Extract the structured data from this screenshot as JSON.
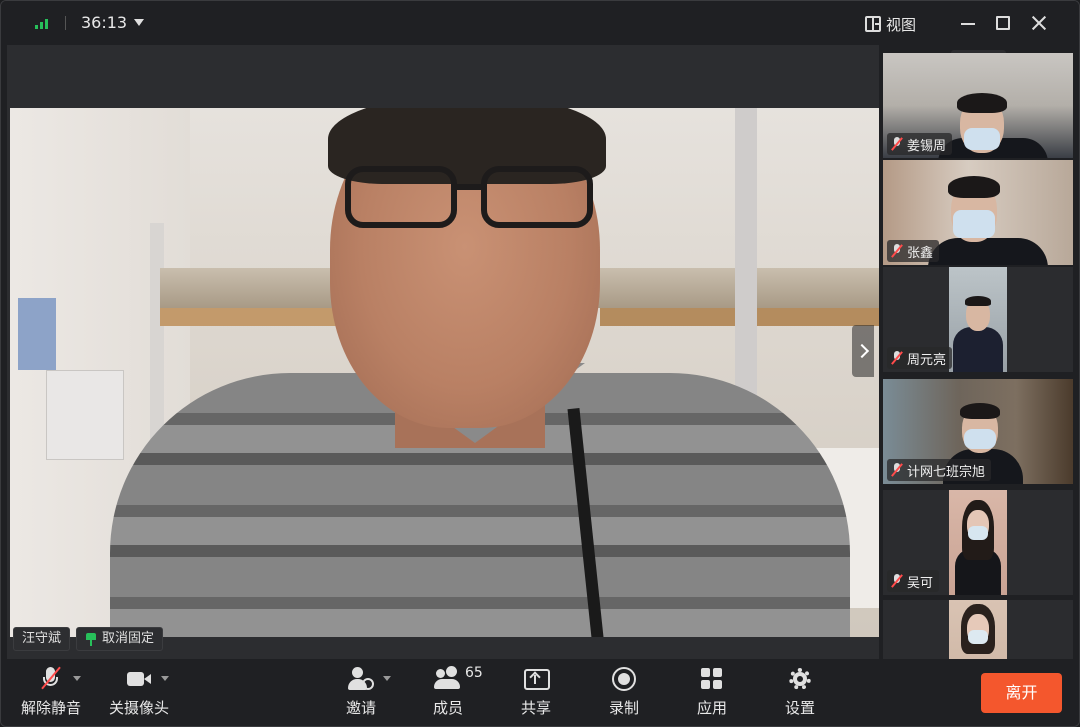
{
  "titlebar": {
    "timer": "36:13",
    "view_label": "视图"
  },
  "main_video": {
    "speaker_name": "汪守斌",
    "unpin_label": "取消固定"
  },
  "gallery": {
    "participants": [
      {
        "name": "姜锡周",
        "muted": true
      },
      {
        "name": "张鑫",
        "muted": true
      },
      {
        "name": "周元亮",
        "muted": true
      },
      {
        "name": "计网七班宗旭",
        "muted": true
      },
      {
        "name": "吴可",
        "muted": true
      }
    ]
  },
  "toolbar": {
    "unmute_label": "解除静音",
    "camera_label": "关摄像头",
    "invite_label": "邀请",
    "members_label": "成员",
    "members_count": "65",
    "share_label": "共享",
    "record_label": "录制",
    "apps_label": "应用",
    "settings_label": "设置",
    "leave_label": "离开"
  },
  "colors": {
    "leave_button": "#f4572d",
    "signal": "#27c05a",
    "muted_mic": "#ff4b4b",
    "background": "#1f2023"
  }
}
